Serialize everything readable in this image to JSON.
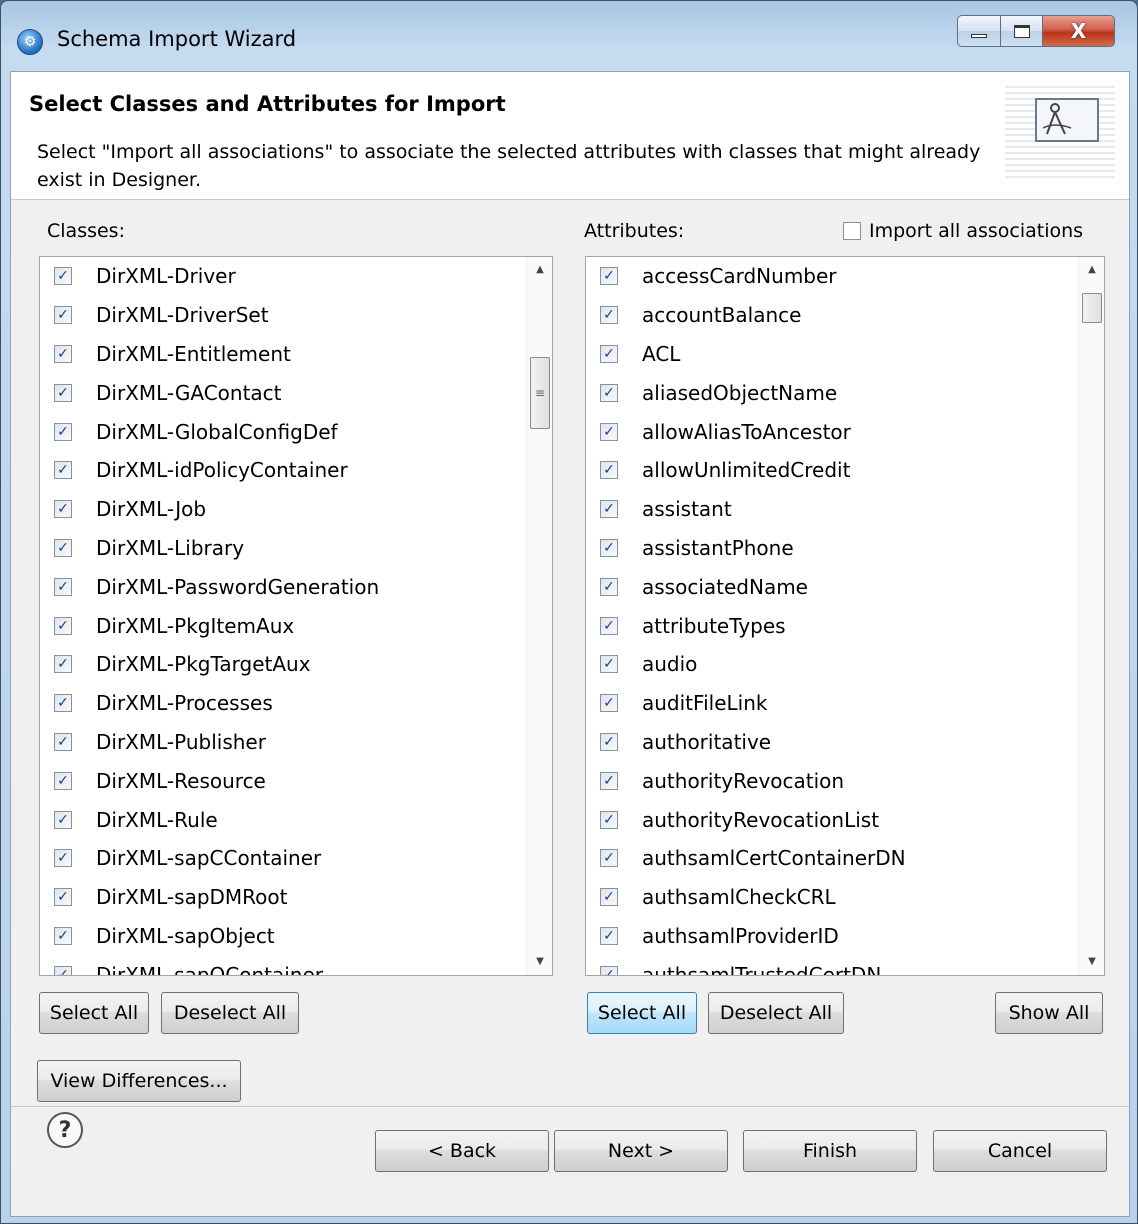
{
  "window": {
    "title": "Schema Import Wizard",
    "icon": "app-globe-icon",
    "close_glyph": "X"
  },
  "header": {
    "title": "Select Classes and Attributes for Import",
    "description": "Select \"Import all associations\" to associate the selected attributes with classes that might already exist in Designer."
  },
  "classes": {
    "label": "Classes:",
    "items": [
      {
        "name": "DirXML-Driver",
        "checked": true
      },
      {
        "name": "DirXML-DriverSet",
        "checked": true
      },
      {
        "name": "DirXML-Entitlement",
        "checked": true
      },
      {
        "name": "DirXML-GAContact",
        "checked": true
      },
      {
        "name": "DirXML-GlobalConfigDef",
        "checked": true
      },
      {
        "name": "DirXML-idPolicyContainer",
        "checked": true
      },
      {
        "name": "DirXML-Job",
        "checked": true
      },
      {
        "name": "DirXML-Library",
        "checked": true
      },
      {
        "name": "DirXML-PasswordGeneration",
        "checked": true
      },
      {
        "name": "DirXML-PkgItemAux",
        "checked": true
      },
      {
        "name": "DirXML-PkgTargetAux",
        "checked": true
      },
      {
        "name": "DirXML-Processes",
        "checked": true
      },
      {
        "name": "DirXML-Publisher",
        "checked": true
      },
      {
        "name": "DirXML-Resource",
        "checked": true
      },
      {
        "name": "DirXML-Rule",
        "checked": true
      },
      {
        "name": "DirXML-sapCContainer",
        "checked": true
      },
      {
        "name": "DirXML-sapDMRoot",
        "checked": true
      },
      {
        "name": "DirXML-sapObject",
        "checked": true
      },
      {
        "name": "DirXML-sapOContainer",
        "checked": true
      }
    ],
    "select_all": "Select All",
    "deselect_all": "Deselect All"
  },
  "attributes": {
    "label": "Attributes:",
    "import_all_label": "Import all associations",
    "import_all_checked": false,
    "items": [
      {
        "name": "accessCardNumber",
        "checked": true
      },
      {
        "name": "accountBalance",
        "checked": true
      },
      {
        "name": "ACL",
        "checked": true
      },
      {
        "name": "aliasedObjectName",
        "checked": true
      },
      {
        "name": "allowAliasToAncestor",
        "checked": true
      },
      {
        "name": "allowUnlimitedCredit",
        "checked": true
      },
      {
        "name": "assistant",
        "checked": true
      },
      {
        "name": "assistantPhone",
        "checked": true
      },
      {
        "name": "associatedName",
        "checked": true
      },
      {
        "name": "attributeTypes",
        "checked": true
      },
      {
        "name": "audio",
        "checked": true
      },
      {
        "name": "auditFileLink",
        "checked": true
      },
      {
        "name": "authoritative",
        "checked": true
      },
      {
        "name": "authorityRevocation",
        "checked": true
      },
      {
        "name": "authorityRevocationList",
        "checked": true
      },
      {
        "name": "authsamlCertContainerDN",
        "checked": true
      },
      {
        "name": "authsamlCheckCRL",
        "checked": true
      },
      {
        "name": "authsamlProviderID",
        "checked": true
      },
      {
        "name": "authsamlTrustedCertDN",
        "checked": true
      }
    ],
    "select_all": "Select All",
    "deselect_all": "Deselect All",
    "show_all": "Show All"
  },
  "view_differences": "View Differences...",
  "footer": {
    "help_glyph": "?",
    "back": "< Back",
    "next": "Next >",
    "finish": "Finish",
    "cancel": "Cancel"
  }
}
